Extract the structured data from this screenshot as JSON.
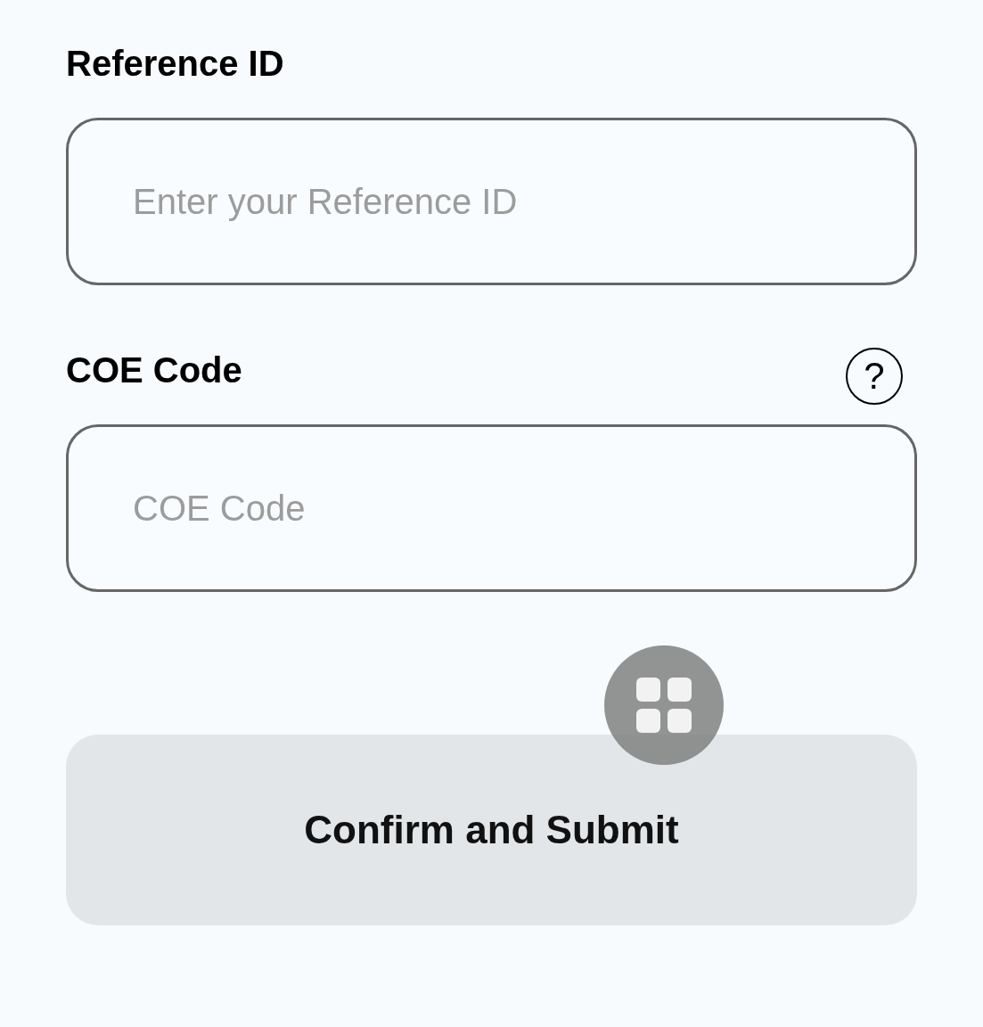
{
  "form": {
    "fields": [
      {
        "label": "Reference ID",
        "placeholder": "Enter your Reference ID"
      },
      {
        "label": "COE Code",
        "placeholder": "COE Code",
        "help": "?"
      }
    ]
  },
  "submit_button": {
    "label": "Confirm and Submit"
  }
}
